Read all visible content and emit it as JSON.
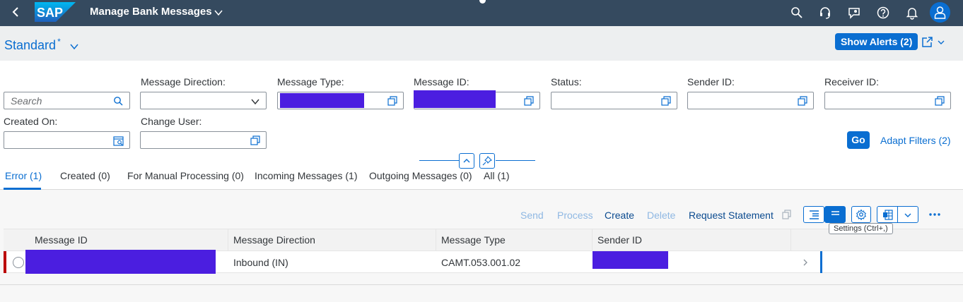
{
  "shell": {
    "title": "Manage Bank Messages",
    "icons": [
      "back-icon",
      "search-icon",
      "headset-icon",
      "feedback-icon",
      "help-icon",
      "bell-icon",
      "user-icon"
    ]
  },
  "header": {
    "variant": "Standard",
    "variant_modified": "*",
    "show_alerts": "Show Alerts (2)"
  },
  "filters": {
    "search_placeholder": "Search",
    "message_direction_label": "Message Direction:",
    "message_type_label": "Message Type:",
    "message_id_label": "Message ID:",
    "status_label": "Status:",
    "sender_id_label": "Sender ID:",
    "receiver_id_label": "Receiver ID:",
    "created_on_label": "Created On:",
    "change_user_label": "Change User:",
    "go": "Go",
    "adapt_filters": "Adapt Filters (2)"
  },
  "tabs": [
    {
      "label": "Error (1)",
      "active": true
    },
    {
      "label": "Created (0)"
    },
    {
      "label": "For Manual Processing (0)"
    },
    {
      "label": "Incoming Messages (1)"
    },
    {
      "label": "Outgoing Messages (0)"
    },
    {
      "label": "All (1)"
    }
  ],
  "toolbar": {
    "send": "Send",
    "process": "Process",
    "create": "Create",
    "delete": "Delete",
    "request_statement": "Request Statement",
    "tooltip": "Settings (Ctrl+,)"
  },
  "table": {
    "columns": [
      "Message ID",
      "Message Direction",
      "Message Type",
      "Sender ID"
    ],
    "rows": [
      {
        "message_direction": "Inbound (IN)",
        "message_type": "CAMT.053.001.02"
      }
    ]
  },
  "colors": {
    "shell": "#354a5f",
    "brand": "#0a6ed1",
    "error": "#bb0000",
    "redaction": "#4b1ee0"
  }
}
